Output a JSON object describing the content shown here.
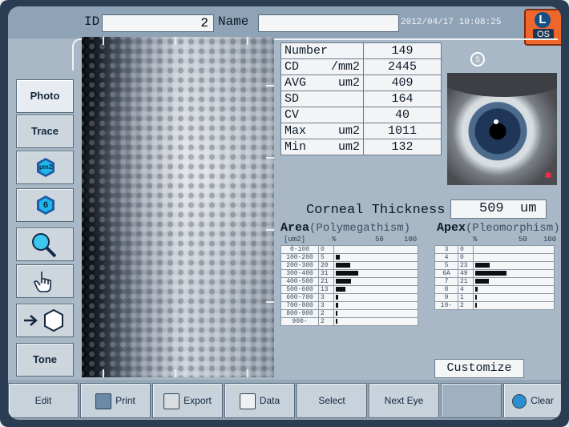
{
  "header": {
    "id_label": "ID",
    "id_value": "2",
    "name_label": "Name",
    "name_value": "",
    "datetime": "2012/04/17 10:08:25",
    "eye_button": {
      "letter": "L",
      "side": "OS"
    }
  },
  "tools": [
    {
      "label": "Photo"
    },
    {
      "label": "Trace"
    },
    {
      "label": "µm2",
      "icon": "area-hex-icon"
    },
    {
      "label": "6",
      "icon": "count-hex-icon"
    },
    {
      "label": "",
      "icon": "magnifier-icon"
    },
    {
      "label": "",
      "icon": "hand-pointer-icon"
    },
    {
      "label": "",
      "icon": "arrow-hex-icon"
    },
    {
      "label": "Tone"
    }
  ],
  "stats": [
    {
      "label": "Number",
      "unit": "",
      "value": "149"
    },
    {
      "label": "CD",
      "unit": "/mm2",
      "value": "2445"
    },
    {
      "label": "AVG",
      "unit": "um2",
      "value": "409"
    },
    {
      "label": "SD",
      "unit": "",
      "value": "164"
    },
    {
      "label": "CV",
      "unit": "",
      "value": "40"
    },
    {
      "label": "Max",
      "unit": "um2",
      "value": "1011"
    },
    {
      "label": "Min",
      "unit": "um2",
      "value": "132"
    }
  ],
  "eye_badge": "S",
  "corneal_thickness": {
    "label": "Corneal Thickness",
    "value": "509",
    "unit": "um"
  },
  "area": {
    "title": "Area",
    "subtitle": "(Polymegathism)",
    "header": {
      "unit": "[um2]",
      "pct": "%",
      "mid": "50",
      "max": "100"
    },
    "rows": [
      {
        "range": "0-100",
        "pct": 0
      },
      {
        "range": "100-200",
        "pct": 5
      },
      {
        "range": "200-300",
        "pct": 20
      },
      {
        "range": "300-400",
        "pct": 31
      },
      {
        "range": "400-500",
        "pct": 21
      },
      {
        "range": "500-600",
        "pct": 13
      },
      {
        "range": "600-700",
        "pct": 3
      },
      {
        "range": "700-800",
        "pct": 3
      },
      {
        "range": "800-900",
        "pct": 2
      },
      {
        "range": "900-",
        "pct": 2
      }
    ]
  },
  "apex": {
    "title": "Apex",
    "subtitle": "(Pleomorphism)",
    "header": {
      "pct": "%",
      "mid": "50",
      "max": "100"
    },
    "rows": [
      {
        "sides": "3",
        "pct": 0
      },
      {
        "sides": "4",
        "pct": 0
      },
      {
        "sides": "5",
        "pct": 23
      },
      {
        "sides": "6A",
        "pct": 49
      },
      {
        "sides": "7",
        "pct": 21
      },
      {
        "sides": "8",
        "pct": 4
      },
      {
        "sides": "9",
        "pct": 1
      },
      {
        "sides": "10-",
        "pct": 2
      }
    ]
  },
  "customize_label": "Customize",
  "bottom": [
    {
      "label": "Edit"
    },
    {
      "label": "Print",
      "icon": "print-icon"
    },
    {
      "label": "Export",
      "icon": "export-icon"
    },
    {
      "label": "Data",
      "icon": "data-icon"
    },
    {
      "label": "Select"
    },
    {
      "label": "Next Eye"
    },
    {
      "label": "Clear",
      "icon": "eraser-icon"
    }
  ],
  "colors": {
    "background": "#a9b8c6",
    "eye_button": "#f0672b",
    "bars": "#0d0f12"
  }
}
